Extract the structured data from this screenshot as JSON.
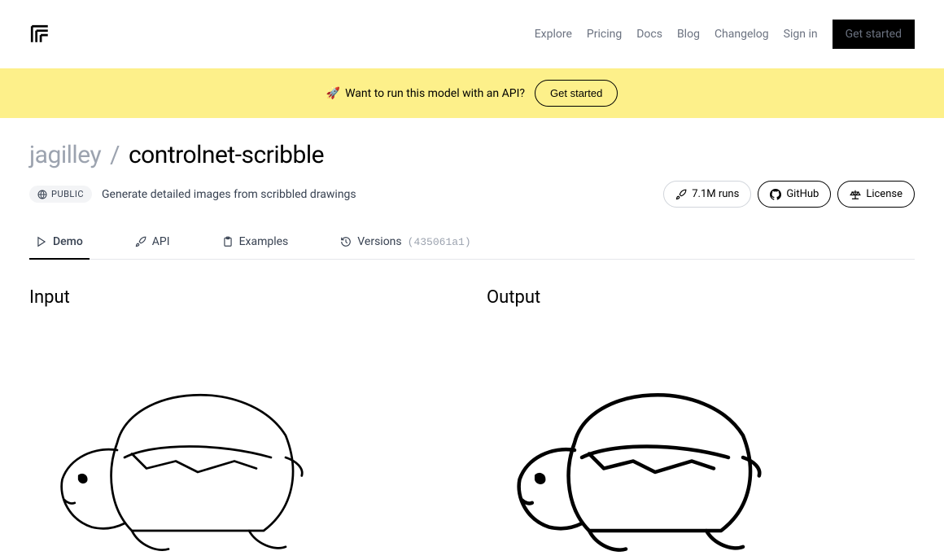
{
  "nav": {
    "explore": "Explore",
    "pricing": "Pricing",
    "docs": "Docs",
    "blog": "Blog",
    "changelog": "Changelog",
    "signin": "Sign in",
    "get_started": "Get started"
  },
  "banner": {
    "emoji": "🚀",
    "text": "Want to run this model with an API?",
    "cta": "Get started"
  },
  "model": {
    "owner": "jagilley",
    "slash": "/",
    "name": "controlnet-scribble",
    "visibility": "PUBLIC",
    "description": "Generate detailed images from scribbled drawings",
    "runs": "7.1M runs",
    "github": "GitHub",
    "license": "License"
  },
  "tabs": {
    "demo": "Demo",
    "api": "API",
    "examples": "Examples",
    "versions": "Versions",
    "version_hash": "(435061a1)"
  },
  "io": {
    "input_heading": "Input",
    "output_heading": "Output"
  }
}
